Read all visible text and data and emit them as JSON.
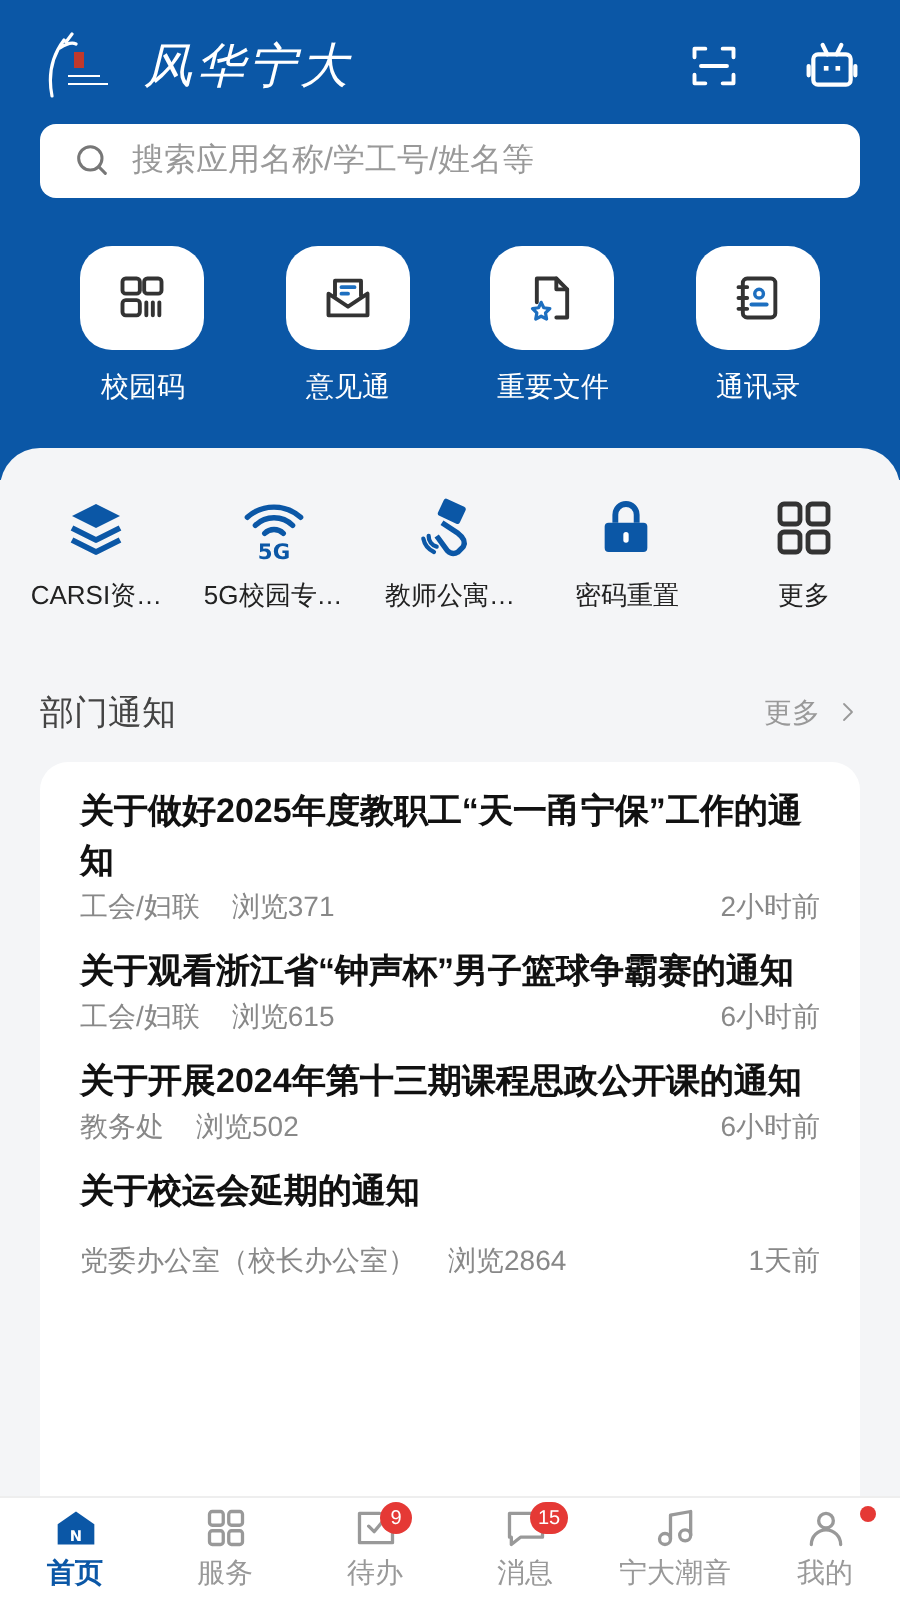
{
  "header": {
    "title": "风华宁大",
    "search": {
      "placeholder": "搜索应用名称/学工号/姓名等"
    }
  },
  "top_apps": [
    {
      "label": "校园码",
      "kind": "qrcode"
    },
    {
      "label": "意见通",
      "kind": "mail"
    },
    {
      "label": "重要文件",
      "kind": "file"
    },
    {
      "label": "通讯录",
      "kind": "contacts"
    }
  ],
  "quick_apps": [
    {
      "label": "CARSI资…",
      "kind": "layers"
    },
    {
      "label": "5G校园专…",
      "kind": "wifi",
      "icon_text": "5G"
    },
    {
      "label": "教师公寓…",
      "kind": "card"
    },
    {
      "label": "密码重置",
      "kind": "lock"
    },
    {
      "label": "更多",
      "kind": "grid"
    }
  ],
  "notices": {
    "title": "部门通知",
    "more": "更多",
    "items": [
      {
        "title": "关于做好2025年度教职工“天一甬宁保”工作的通知",
        "source": "工会/妇联",
        "views": "浏览371",
        "time": "2小时前"
      },
      {
        "title": "关于观看浙江省“钟声杯”男子篮球争霸赛的通知",
        "source": "工会/妇联",
        "views": "浏览615",
        "time": "6小时前"
      },
      {
        "title": "关于开展2024年第十三期课程思政公开课的通知",
        "source": "教务处",
        "views": "浏览502",
        "time": "6小时前"
      },
      {
        "title": "关于校运会延期的通知",
        "source": "党委办公室（校长办公室）",
        "views": "浏览2864",
        "time": "1天前"
      }
    ]
  },
  "tabbar": [
    {
      "label": "首页",
      "kind": "home",
      "icon_text": "N",
      "selected": true
    },
    {
      "label": "服务",
      "kind": "grid",
      "selected": false
    },
    {
      "label": "待办",
      "kind": "todo",
      "selected": false,
      "badge": "9"
    },
    {
      "label": "消息",
      "kind": "message",
      "selected": false,
      "badge": "15"
    },
    {
      "label": "宁大潮音",
      "kind": "music",
      "selected": false
    },
    {
      "label": "我的",
      "kind": "user",
      "selected": false,
      "dot": true
    }
  ]
}
